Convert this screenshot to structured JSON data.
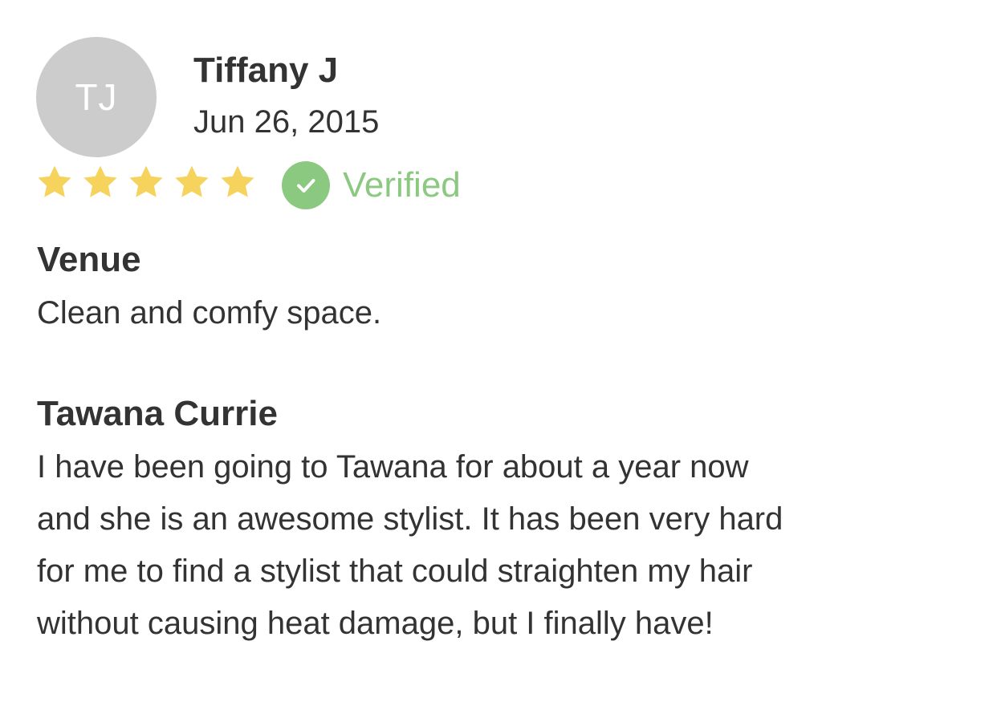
{
  "review": {
    "avatar": {
      "initials": "TJ",
      "color": "#cccccc"
    },
    "reviewer_name": "Tiffany J",
    "date": "Jun 26, 2015",
    "rating": {
      "value": 5,
      "max": 5,
      "color": "#f5d35c",
      "icon": "star-icon"
    },
    "verified": {
      "label": "Verified",
      "color": "#8cc980",
      "icon": "check-circle-icon"
    },
    "sections": [
      {
        "title": "Venue",
        "lines": [
          "Clean and comfy space."
        ]
      },
      {
        "title": "Tawana Currie",
        "lines": [
          "I have been going to Tawana for about a year now",
          "and she is an awesome stylist. It has been very hard",
          "for me to find a stylist that could straighten my hair",
          "without causing heat damage, but I finally have!"
        ]
      }
    ]
  }
}
